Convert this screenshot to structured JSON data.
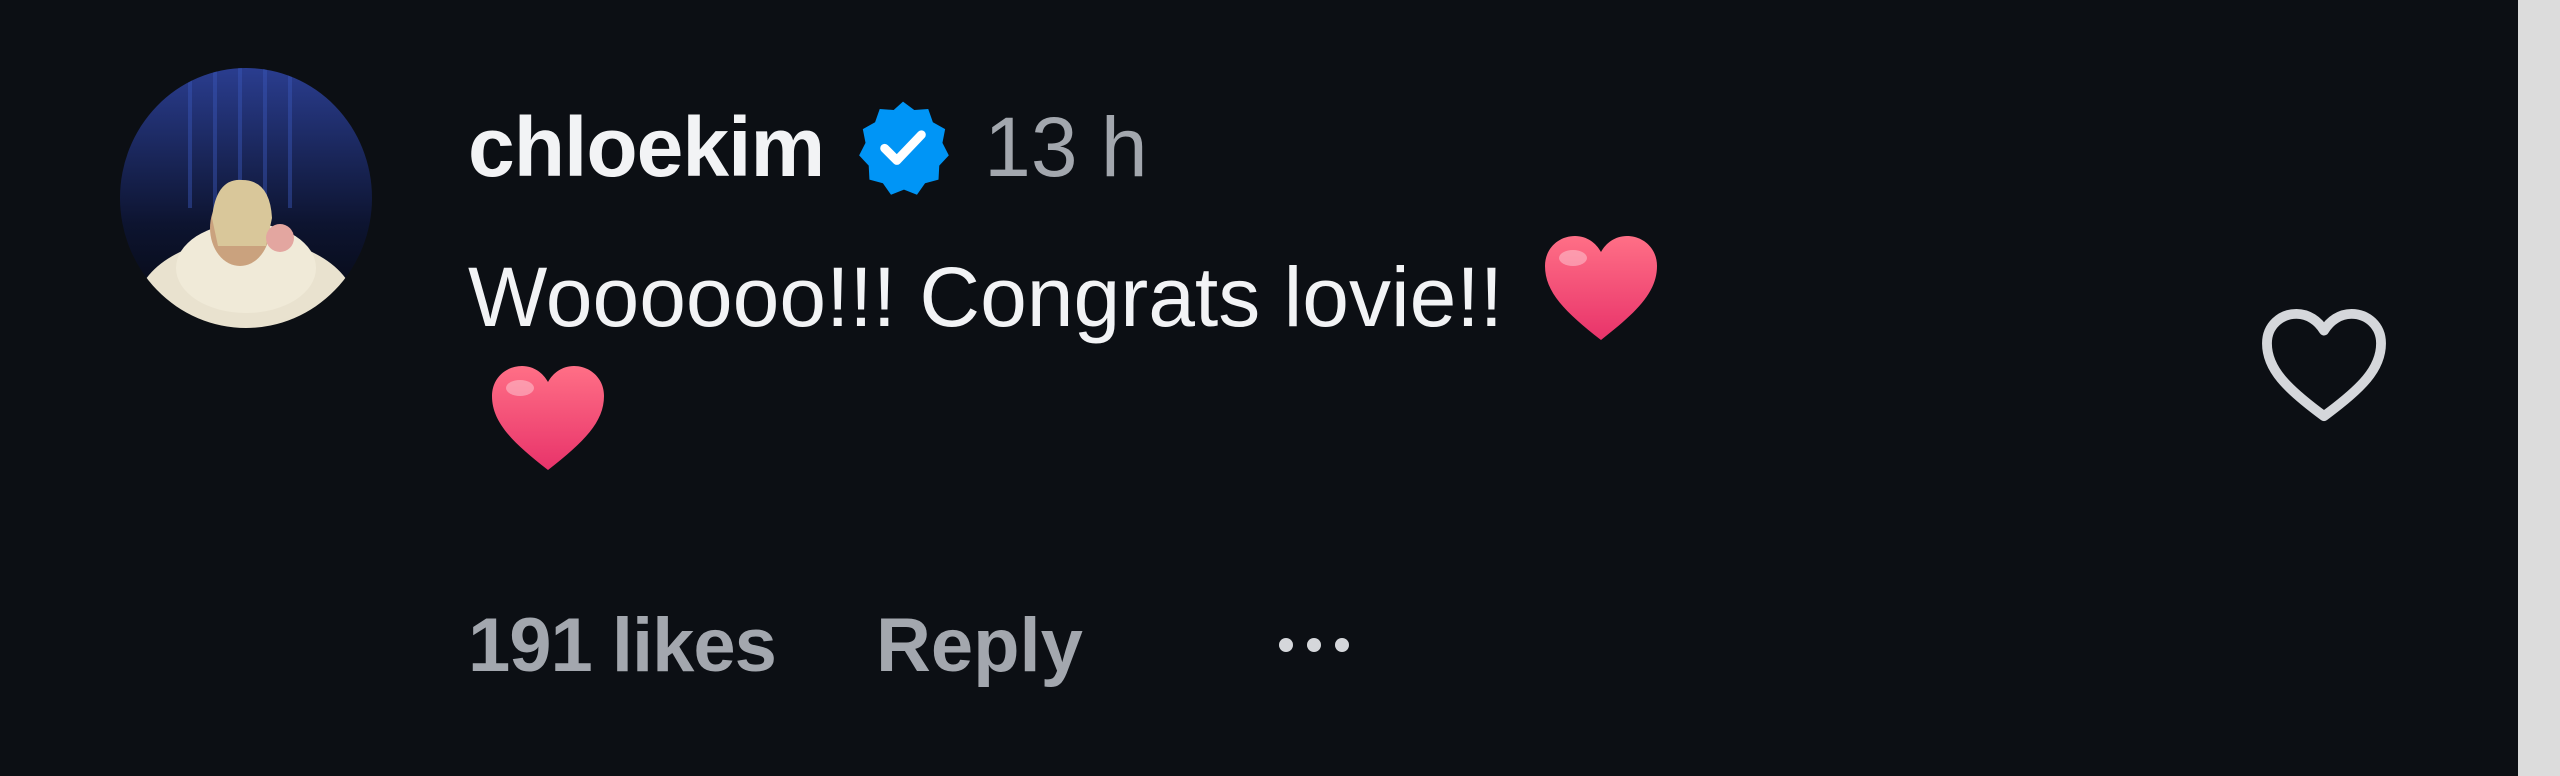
{
  "comment": {
    "username": "chloekim",
    "verified_icon": "verified-badge-icon",
    "timestamp": "13 h",
    "text": "Woooooo!!! Congrats lovie!!",
    "emoji": [
      "red-heart-emoji",
      "red-heart-emoji"
    ],
    "likes_label": "191 likes",
    "reply_label": "Reply",
    "more_icon": "more-options-icon",
    "like_icon": "heart-outline-icon",
    "avatar_icon": "user-avatar"
  },
  "colors": {
    "background": "#0c0f14",
    "primary_text": "#f2f3f5",
    "secondary_text": "#a3a7ae",
    "verified_blue": "#0095f6",
    "heart_pink": "#f2456f"
  }
}
